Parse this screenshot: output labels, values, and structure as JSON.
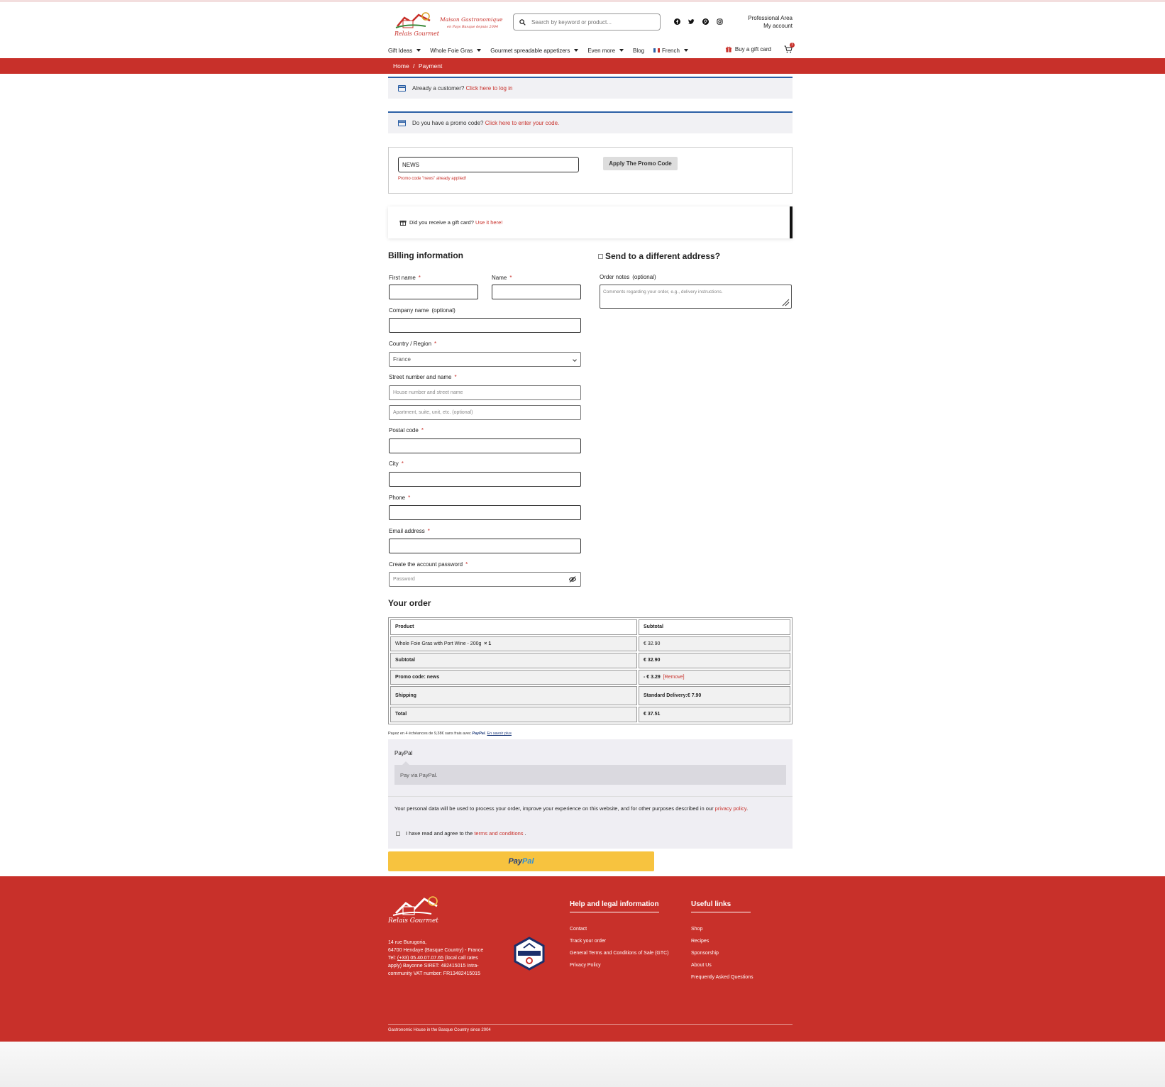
{
  "header": {
    "logo_name": "Relais Gourmet",
    "logo_tagline": "Maison Gastronomique",
    "logo_subtagline": "en Pays Basque depuis 2004",
    "search_placeholder": "Search by keyword or product...",
    "socials": [
      "facebook-icon",
      "twitter-icon",
      "pinterest-icon",
      "instagram-icon"
    ],
    "professional_area": "Professional Area",
    "my_account": "My account"
  },
  "nav": {
    "items": [
      {
        "label": "Gift Ideas",
        "dropdown": true
      },
      {
        "label": "Whole Foie Gras",
        "dropdown": true
      },
      {
        "label": "Gourmet spreadable appetizers",
        "dropdown": true
      },
      {
        "label": "Even more",
        "dropdown": true
      },
      {
        "label": "Blog",
        "dropdown": false
      }
    ],
    "language": "French",
    "buy_gift_card": "Buy a gift card",
    "cart_count": "1"
  },
  "breadcrumb": {
    "home": "Home",
    "separator": "/",
    "current": "Payment"
  },
  "notices": {
    "customer_text": "Already a customer?",
    "customer_link": "Click here to log in",
    "promo_text": "Do you have a promo code?",
    "promo_link": "Click here to enter your code."
  },
  "promo": {
    "value": "NEWS",
    "message": "Promo code \"news\" already applied!",
    "apply_label": "Apply The Promo Code"
  },
  "gift": {
    "text": "Did you receive a gift card?",
    "link": "Use it here!"
  },
  "billing": {
    "title": "Billing information",
    "first_name": "First name",
    "name": "Name",
    "company": "Company name",
    "optional": "(optional)",
    "country_label": "Country / Region",
    "country_value": "France",
    "street_label": "Street number and name",
    "street_placeholder": "House number and street name",
    "street2_placeholder": "Apartment, suite, unit, etc. (optional)",
    "postal_label": "Postal code",
    "city_label": "City",
    "phone_label": "Phone",
    "email_label": "Email address",
    "password_label": "Create the account password",
    "password_placeholder": "Password",
    "required_mark": "*"
  },
  "shipping": {
    "title": "Send to a different address?",
    "notes_label": "Order notes",
    "notes_optional": "(optional)",
    "notes_placeholder": "Comments regarding your order, e.g., delivery instructions."
  },
  "order": {
    "title": "Your order",
    "header_product": "Product",
    "header_subtotal": "Subtotal",
    "item_name": "Whole Foie Gras with Port Wine - 200g",
    "item_qty": "× 1",
    "item_price": "€ 32.90",
    "subtotal_label": "Subtotal",
    "subtotal_value": "€ 32.90",
    "promo_label": "Promo code: news",
    "promo_value": "- € 3.29",
    "promo_remove": "[Remove]",
    "shipping_label": "Shipping",
    "shipping_method": "Standard Delivery:",
    "shipping_value": "€ 7.90",
    "total_label": "Total",
    "total_value": "€ 37.51"
  },
  "payment": {
    "paypal_note_prefix": "Payez en 4 échéances de 9,38€ sans frais avec",
    "paypal_brand": "PayPal",
    "paypal_more": "En savoir plus",
    "method_label": "PayPal",
    "method_desc": "Pay via PayPal.",
    "privacy_text": "Your personal data will be used to process your order, improve your experience on this website, and for other purposes described in our",
    "privacy_link": "privacy policy",
    "privacy_end": ".",
    "terms_text": "I have read and agree to the",
    "terms_link": "terms and conditions",
    "terms_end": ".",
    "button_pay": "Pay",
    "button_pal": "Pal"
  },
  "footer": {
    "logo_name": "Relais Gourmet",
    "address_line1": "14 rue Burugoria,",
    "address_line2": "64700 Hendaye (Basque Country) - France",
    "tel_label": "Tel:",
    "tel_number": "(+33) 05.40.07.07.65",
    "tel_rest": "(local call rates apply) Bayonne SIRET: 482415015 Intra-community VAT number: FR13482415015",
    "help_title": "Help and legal information",
    "help_links": [
      "Contact",
      "Track your order",
      "General Terms and Conditions of Sale (GTC)",
      "Privacy Policy"
    ],
    "useful_title": "Useful links",
    "useful_links": [
      "Shop",
      "Recipes",
      "Sponsorship",
      "About Us",
      "Frequently Asked Questions"
    ],
    "copyright": "Gastronomic House in the Basque Country since 2004"
  },
  "colors": {
    "brand_red": "#c8302a",
    "notice_blue": "#2b5fa5",
    "paypal_yellow": "#f7c33f"
  }
}
